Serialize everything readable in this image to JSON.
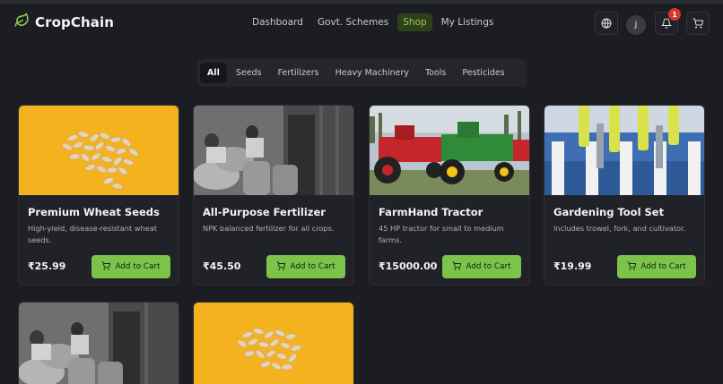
{
  "app": {
    "name": "CropChain"
  },
  "nav": {
    "items": [
      {
        "label": "Dashboard",
        "active": false
      },
      {
        "label": "Govt. Schemes",
        "active": false
      },
      {
        "label": "Shop",
        "active": true
      },
      {
        "label": "My Listings",
        "active": false
      }
    ]
  },
  "header": {
    "avatar_initial": "J",
    "notification_count": "1",
    "icons": [
      "globe-icon",
      "bell-icon",
      "cart-icon"
    ]
  },
  "categories": {
    "tabs": [
      {
        "label": "All",
        "active": true
      },
      {
        "label": "Seeds",
        "active": false
      },
      {
        "label": "Fertilizers",
        "active": false
      },
      {
        "label": "Heavy Machinery",
        "active": false
      },
      {
        "label": "Tools",
        "active": false
      },
      {
        "label": "Pesticides",
        "active": false
      }
    ]
  },
  "products": [
    {
      "title": "Premium Wheat Seeds",
      "description": "High-yield, disease-resistant wheat seeds.",
      "price": "₹25.99",
      "button": "Add to Cart",
      "image": "seeds"
    },
    {
      "title": "All-Purpose Fertilizer",
      "description": "NPK balanced fertilizer for all crops.",
      "price": "₹45.50",
      "button": "Add to Cart",
      "image": "sacks-photo"
    },
    {
      "title": "FarmHand Tractor",
      "description": "45 HP tractor for small to medium farms.",
      "price": "₹15000.00",
      "button": "Add to Cart",
      "image": "tractors"
    },
    {
      "title": "Gardening Tool Set",
      "description": "Includes trowel, fork, and cultivator.",
      "price": "₹19.99",
      "button": "Add to Cart",
      "image": "tools"
    },
    {
      "image": "sacks-photo"
    },
    {
      "image": "seeds"
    }
  ],
  "colors": {
    "background": "#1b1d22",
    "accent": "#7cc34a",
    "active_nav_bg": "#2e3f1a",
    "badge": "#d9342b"
  }
}
